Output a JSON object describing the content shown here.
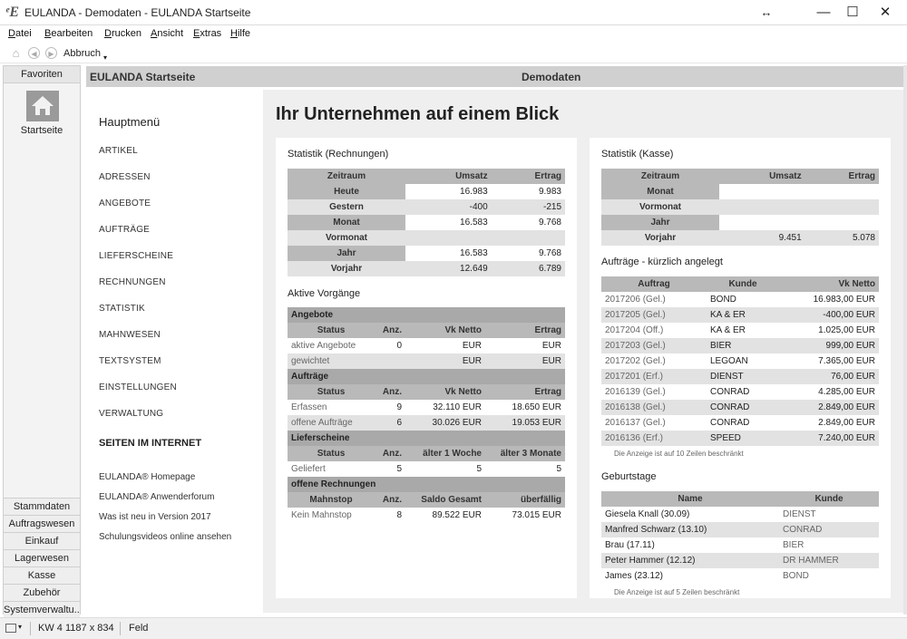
{
  "window": {
    "app_icon": "ᵉE",
    "title": "EULANDA - Demodaten - EULANDA Startseite",
    "resize_glyph": "↔",
    "min_glyph": "—",
    "max_glyph": "☐",
    "close_glyph": "✕"
  },
  "menu": {
    "items": [
      {
        "u": "D",
        "rest": "atei"
      },
      {
        "u": "B",
        "rest": "earbeiten"
      },
      {
        "u": "D",
        "rest": "rucken"
      },
      {
        "u": "A",
        "rest": "nsicht"
      },
      {
        "u": "E",
        "rest": "xtras"
      },
      {
        "u": "H",
        "rest": "ilfe"
      }
    ]
  },
  "toolbar": {
    "home": "⌂",
    "back": "◀",
    "forward": "▶",
    "abbruch": "Abbruch",
    "caret": "▾"
  },
  "left": {
    "fav_tab": "Favoriten",
    "start_label": "Startseite",
    "categories": [
      "Stammdaten",
      "Auftragswesen",
      "Einkauf",
      "Lagerwesen",
      "Kasse",
      "Zubehör",
      "Systemverwaltu..."
    ]
  },
  "header": {
    "left": "EULANDA Startseite",
    "center": "Demodaten"
  },
  "nav": {
    "title": "Hauptmenü",
    "items": [
      "ARTIKEL",
      "ADRESSEN",
      "ANGEBOTE",
      "AUFTRÄGE",
      "LIEFERSCHEINE",
      "RECHNUNGEN",
      "STATISTIK",
      "MAHNWESEN",
      "TEXTSYSTEM",
      "EINSTELLUNGEN",
      "VERWALTUNG"
    ],
    "internet_title": "SEITEN IM INTERNET",
    "links": [
      "EULANDA® Homepage",
      "EULANDA® Anwenderforum",
      "Was ist neu in Version 2017",
      "Schulungsvideos online ansehen"
    ]
  },
  "page_title": "Ihr Unternehmen auf einem Blick",
  "rechnungen": {
    "title": "Statistik (Rechnungen)",
    "headers": [
      "Zeitraum",
      "Umsatz",
      "Ertrag"
    ],
    "rows": [
      [
        "Heute",
        "16.983",
        "9.983"
      ],
      [
        "Gestern",
        "-400",
        "-215"
      ],
      [
        "Monat",
        "16.583",
        "9.768"
      ],
      [
        "Vormonat",
        "",
        ""
      ],
      [
        "Jahr",
        "16.583",
        "9.768"
      ],
      [
        "Vorjahr",
        "12.649",
        "6.789"
      ]
    ]
  },
  "vorgaenge": {
    "title": "Aktive Vorgänge",
    "angebote": {
      "group": "Angebote",
      "headers": [
        "Status",
        "Anz.",
        "Vk Netto",
        "Ertrag"
      ],
      "rows": [
        [
          "aktive Angebote",
          "0",
          "EUR",
          "EUR"
        ],
        [
          "gewichtet",
          "",
          "EUR",
          "EUR"
        ]
      ]
    },
    "auftraege": {
      "group": "Aufträge",
      "headers": [
        "Status",
        "Anz.",
        "Vk Netto",
        "Ertrag"
      ],
      "rows": [
        [
          "Erfassen",
          "9",
          "32.110 EUR",
          "18.650 EUR"
        ],
        [
          "offene Aufträge",
          "6",
          "30.026 EUR",
          "19.053 EUR"
        ]
      ]
    },
    "lieferscheine": {
      "group": "Lieferscheine",
      "headers": [
        "Status",
        "Anz.",
        "älter 1 Woche",
        "älter 3 Monate"
      ],
      "rows": [
        [
          "Geliefert",
          "5",
          "5",
          "5"
        ]
      ]
    },
    "rechnungen": {
      "group": "offene Rechnungen",
      "headers": [
        "Mahnstop",
        "Anz.",
        "Saldo Gesamt",
        "überfällig"
      ],
      "rows": [
        [
          "Kein Mahnstop",
          "8",
          "89.522 EUR",
          "73.015 EUR"
        ]
      ]
    }
  },
  "kasse": {
    "title": "Statistik (Kasse)",
    "headers": [
      "Zeitraum",
      "Umsatz",
      "Ertrag"
    ],
    "rows": [
      [
        "Monat",
        "",
        ""
      ],
      [
        "Vormonat",
        "",
        ""
      ],
      [
        "Jahr",
        "",
        ""
      ],
      [
        "Vorjahr",
        "9.451",
        "5.078"
      ]
    ]
  },
  "auftraege_recent": {
    "title": "Aufträge - kürzlich angelegt",
    "headers": [
      "Auftrag",
      "Kunde",
      "Vk Netto"
    ],
    "rows": [
      [
        "2017206 (Gel.)",
        "BOND",
        "16.983,00 EUR"
      ],
      [
        "2017205 (Gel.)",
        "KA & ER",
        "-400,00 EUR"
      ],
      [
        "2017204 (Off.)",
        "KA & ER",
        "1.025,00 EUR"
      ],
      [
        "2017203 (Gel.)",
        "BIER",
        "999,00 EUR"
      ],
      [
        "2017202 (Gel.)",
        "LEGOAN",
        "7.365,00 EUR"
      ],
      [
        "2017201 (Erf.)",
        "DIENST",
        "76,00 EUR"
      ],
      [
        "2016139 (Gel.)",
        "CONRAD",
        "4.285,00 EUR"
      ],
      [
        "2016138 (Gel.)",
        "CONRAD",
        "2.849,00 EUR"
      ],
      [
        "2016137 (Gel.)",
        "CONRAD",
        "2.849,00 EUR"
      ],
      [
        "2016136 (Erf.)",
        "SPEED",
        "7.240,00 EUR"
      ]
    ],
    "note": "Die Anzeige ist auf 10 Zeilen beschränkt"
  },
  "geburtstage": {
    "title": "Geburtstage",
    "headers": [
      "Name",
      "Kunde"
    ],
    "rows": [
      [
        "Giesela Knall (30.09)",
        "DIENST"
      ],
      [
        "Manfred Schwarz (13.10)",
        "CONRAD"
      ],
      [
        "Brau (17.11)",
        "BIER"
      ],
      [
        "Peter Hammer (12.12)",
        "DR HAMMER"
      ],
      [
        "James (23.12)",
        "BOND"
      ]
    ],
    "note": "Die Anzeige ist auf 5 Zeilen beschränkt"
  },
  "statusbar": {
    "kw": "KW 4",
    "size": "1187 x 834",
    "field": "Feld"
  }
}
